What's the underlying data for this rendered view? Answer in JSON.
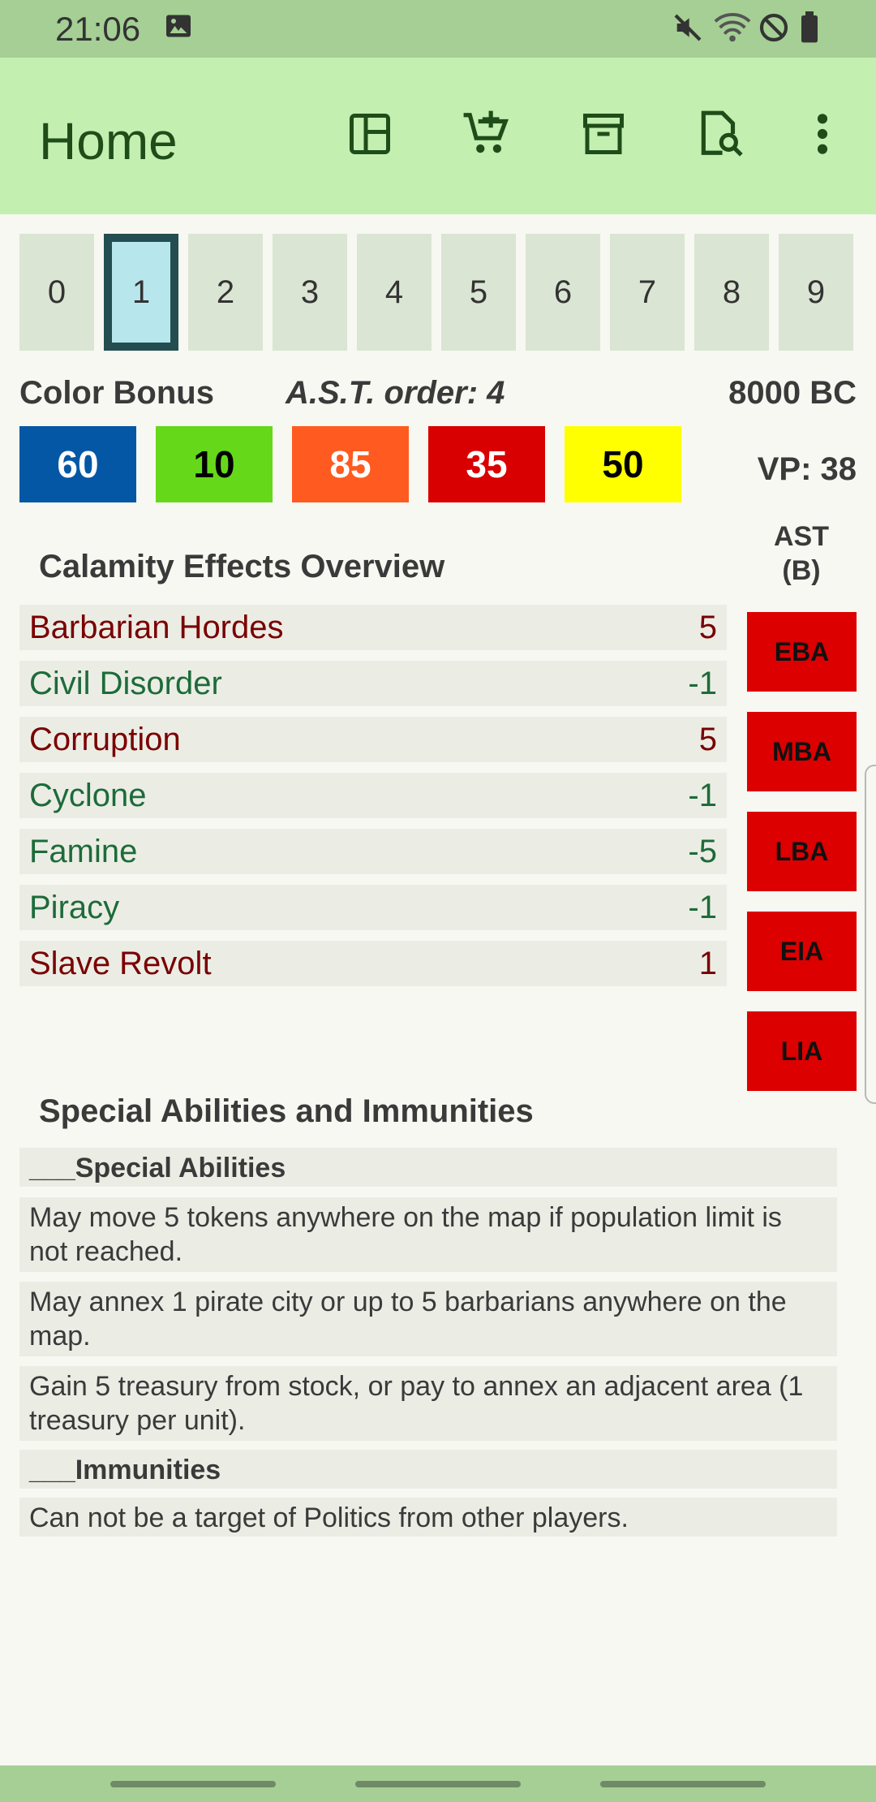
{
  "status_bar": {
    "time": "21:06",
    "icons": [
      "image-icon",
      "mute-icon",
      "wifi-icon",
      "do-not-disturb-icon",
      "battery-icon"
    ]
  },
  "app_bar": {
    "title": "Home",
    "actions": [
      "layout-icon",
      "add-cart-icon",
      "archive-icon",
      "search-document-icon",
      "more-vert-icon"
    ]
  },
  "tabs": {
    "items": [
      "0",
      "1",
      "2",
      "3",
      "4",
      "5",
      "6",
      "7",
      "8",
      "9"
    ],
    "selected": "1"
  },
  "info": {
    "color_bonus_label": "Color Bonus",
    "ast_order": "A.S.T. order: 4",
    "era": "8000 BC",
    "vp": "VP: 38"
  },
  "color_bonus": [
    {
      "value": "60",
      "color": "#0457a5",
      "text_color": "#ffffff"
    },
    {
      "value": "10",
      "color": "#66d81a",
      "text_color": "#000000"
    },
    {
      "value": "85",
      "color": "#ff5a20",
      "text_color": "#ffffff"
    },
    {
      "value": "35",
      "color": "#d80000",
      "text_color": "#ffffff"
    },
    {
      "value": "50",
      "color": "#ffff00",
      "text_color": "#000000"
    }
  ],
  "calamity": {
    "title": "Calamity Effects Overview",
    "rows": [
      {
        "name": "Barbarian Hordes",
        "value": "5",
        "color": "#7a0000"
      },
      {
        "name": "Civil Disorder",
        "value": "-1",
        "color": "#1d6b3a"
      },
      {
        "name": "Corruption",
        "value": "5",
        "color": "#7a0000"
      },
      {
        "name": "Cyclone",
        "value": "-1",
        "color": "#1d6b3a"
      },
      {
        "name": "Famine",
        "value": "-5",
        "color": "#1d6b3a"
      },
      {
        "name": "Piracy",
        "value": "-1",
        "color": "#1d6b3a"
      },
      {
        "name": "Slave Revolt",
        "value": "1",
        "color": "#7a0000"
      }
    ]
  },
  "ast": {
    "header_line1": "AST",
    "header_line2": "(B)",
    "boxes": [
      "EBA",
      "MBA",
      "LBA",
      "EIA",
      "LIA"
    ],
    "color": "#dc0000"
  },
  "special": {
    "title": "Special Abilities and Immunities",
    "abilities_header": "___Special Abilities",
    "abilities": [
      "May move 5 tokens anywhere on the map if population limit is not reached.",
      "May annex 1 pirate city or up to 5 barbarians anywhere on the map.",
      "Gain 5 treasury from stock, or pay to annex an adjacent area (1 treasury per unit)."
    ],
    "immunities_header": "___Immunities",
    "immunities": [
      "Can not be a target of Politics from other players."
    ]
  }
}
